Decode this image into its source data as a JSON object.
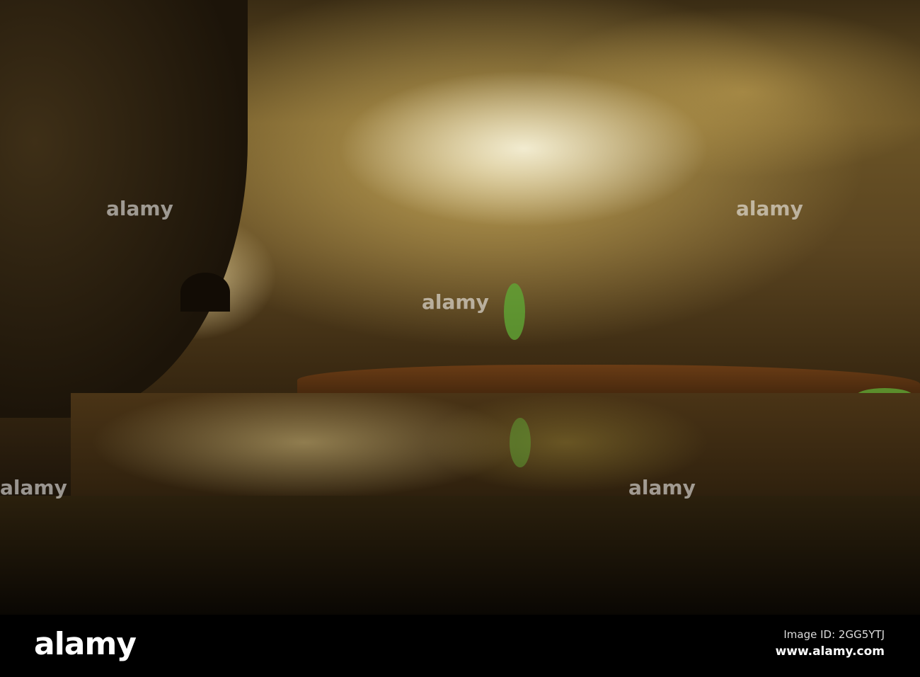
{
  "watermark": "alamy",
  "footer": {
    "logo": "alamy",
    "image_id": "Image ID: 2GG5YTJ",
    "site": "www.alamy.com"
  }
}
